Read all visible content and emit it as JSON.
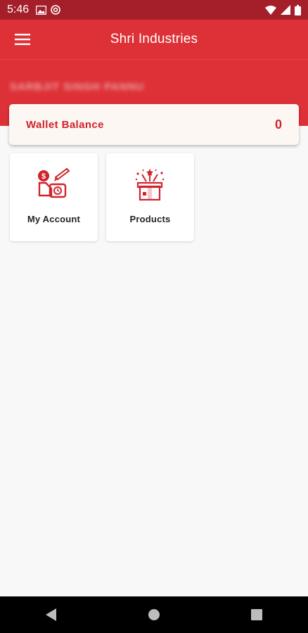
{
  "status_bar": {
    "time": "5:46",
    "icons_left": [
      "image-icon",
      "at-sign-icon"
    ],
    "icons_right": [
      "wifi-icon",
      "signal-icon",
      "battery-icon"
    ]
  },
  "toolbar": {
    "title": "Shri Industries",
    "menu_icon": "hamburger-menu-icon"
  },
  "header": {
    "user_name": "SARBJIT SINGH PANNU"
  },
  "wallet": {
    "label": "Wallet Balance",
    "value": "0"
  },
  "tiles": [
    {
      "label": "My Account",
      "icon": "account-money-icon"
    },
    {
      "label": "Products",
      "icon": "gift-box-icon"
    }
  ],
  "nav": {
    "back": "back-icon",
    "home": "home-icon",
    "recents": "recents-icon"
  },
  "colors": {
    "primary": "#dd3137",
    "status_bar": "#a51f2a",
    "accent_text": "#d0232c",
    "background": "#f8f8f8"
  }
}
